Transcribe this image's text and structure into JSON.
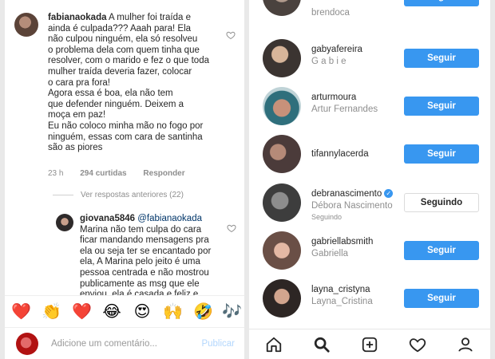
{
  "comment": {
    "username": "fabianaokada",
    "lines": [
      " A mulher foi traída e",
      "ainda é culpada??? Aaah para! Ela",
      "não culpou ninguém, ela só resolveu",
      "o problema dela com quem tinha que",
      "resolver, com o marido e fez o que toda",
      "mulher traída deveria fazer, colocar",
      "o cara pra fora!",
      "Agora essa é boa, ela não tem",
      "que defender ninguém. Deixem a",
      "moça em paz!",
      "Eu não coloco minha mão no fogo por",
      "ninguém, essas com cara de santinha",
      "são as piores"
    ],
    "time": "23 h",
    "likes": "294 curtidas",
    "reply_label": "Responder"
  },
  "view_previous": "Ver respostas anteriores (22)",
  "reply": {
    "username": "giovana5846",
    "mention": "@fabianaokada",
    "lines": [
      "Marina não tem culpa do cara",
      "ficar mandando mensagens pra",
      "ela ou seja ter se encantado por",
      "ela, A Marina pelo jeito é uma",
      "pessoa centrada e não mostrou",
      "publicamente as msg que ele",
      "enviou, ela é casada e feliz e"
    ]
  },
  "emojis": [
    "❤️",
    "👏",
    "❤️",
    "😂",
    "😍",
    "🙌",
    "🤣",
    "🎶"
  ],
  "comment_input": {
    "placeholder": "Adicione um comentário...",
    "publish": "Publicar"
  },
  "follow_list": [
    {
      "username": "brendoca",
      "fullname": "",
      "button": "Seguir",
      "verified": false
    },
    {
      "username": "gabyafereira",
      "fullname": "G a b i e",
      "button": "Seguir",
      "verified": false
    },
    {
      "username": "arturmoura",
      "fullname": "Artur Fernandes",
      "button": "Seguir",
      "verified": false
    },
    {
      "username": "tifannylacerda",
      "fullname": "",
      "button": "Seguir",
      "verified": false
    },
    {
      "username": "debranascimento",
      "fullname": "Débora Nascimento",
      "subtitle": "Seguindo",
      "button": "Seguindo",
      "verified": true
    },
    {
      "username": "gabriellabsmith",
      "fullname": "Gabriella",
      "button": "Seguir",
      "verified": false
    },
    {
      "username": "layna_cristyna",
      "fullname": "Layna_Cristina",
      "button": "Seguir",
      "verified": false
    }
  ],
  "tabs": [
    "home-icon",
    "search-icon",
    "add-icon",
    "heart-icon",
    "profile-icon"
  ],
  "colors": {
    "follow_blue": "#3897f0",
    "publish_disabled": "#b3d7fd",
    "verified_blue": "#3897f0"
  }
}
